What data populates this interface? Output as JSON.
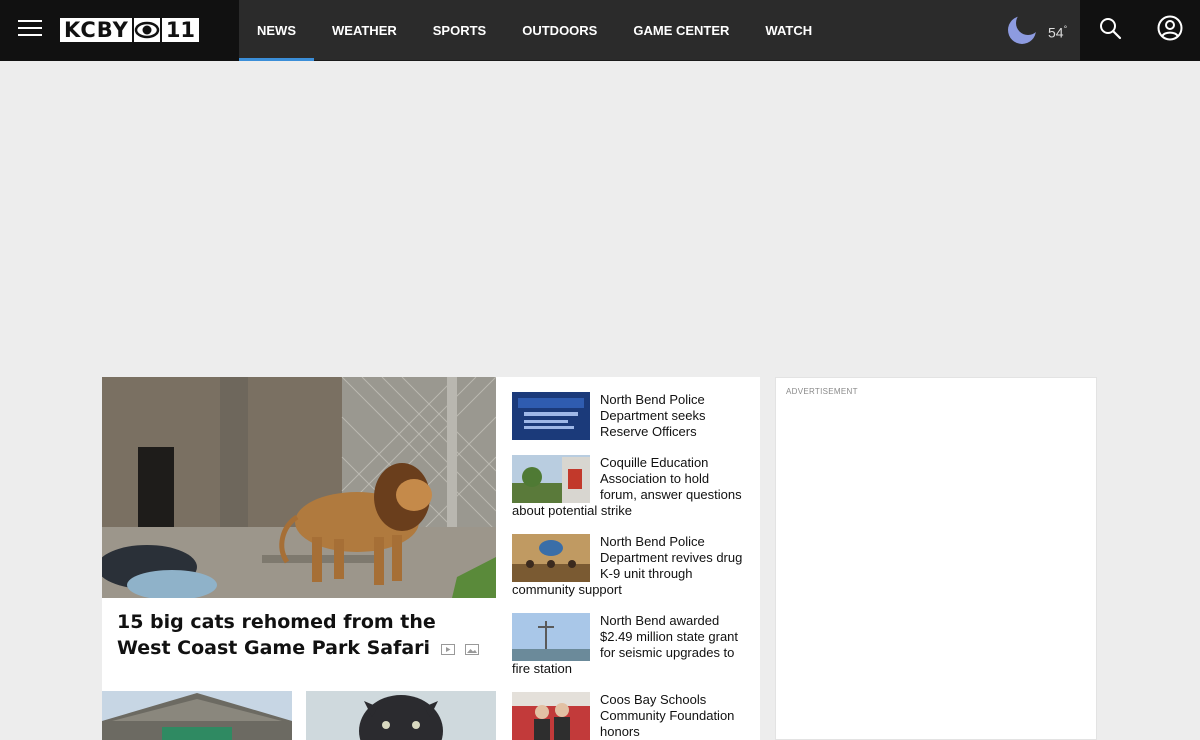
{
  "header": {
    "logo_text": "KCBY",
    "logo_number": "11",
    "nav": [
      {
        "label": "NEWS",
        "active": true
      },
      {
        "label": "WEATHER"
      },
      {
        "label": "SPORTS"
      },
      {
        "label": "OUTDOORS"
      },
      {
        "label": "GAME CENTER"
      },
      {
        "label": "WATCH"
      }
    ],
    "weather": {
      "temperature": "54",
      "degree": "°",
      "icon": "moon-icon"
    }
  },
  "hero": {
    "title": "15 big cats rehomed from the West Coast Game Park Safari",
    "icons": [
      "video-icon",
      "gallery-icon"
    ]
  },
  "stories": [
    {
      "headline": "North Bend Police Department seeks Reserve Officers"
    },
    {
      "headline": "Coquille Education Association to hold forum, answer questions about potential strike"
    },
    {
      "headline": "North Bend Police Department revives drug K-9 unit through community support"
    },
    {
      "headline": "North Bend awarded $2.49 million state grant for seismic upgrades to fire station"
    },
    {
      "headline": "Coos Bay Schools Community Foundation honors"
    }
  ],
  "ad": {
    "label": "ADVERTISEMENT"
  },
  "colors": {
    "accent": "#3b8ed8",
    "header_bg": "#2b2b2b",
    "brand_bg": "#111111",
    "moon": "#8d9be0"
  }
}
